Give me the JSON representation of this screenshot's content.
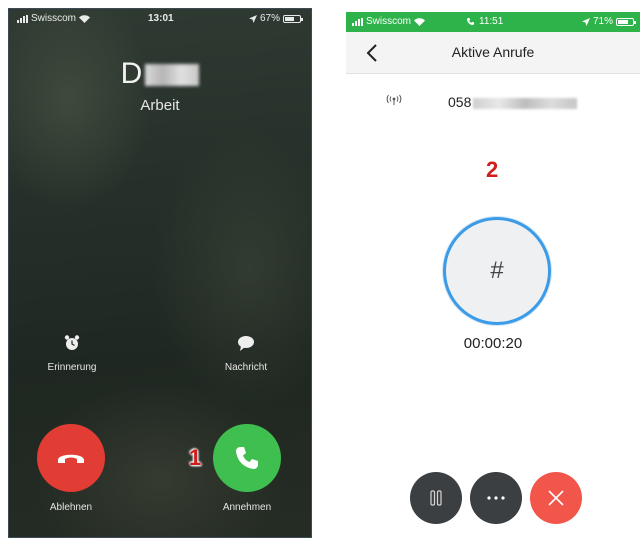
{
  "left_phone": {
    "status_bar": {
      "carrier": "Swisscom",
      "time": "13:01",
      "battery": "67%",
      "battery_level": 0.67
    },
    "caller": {
      "name_visible": "D",
      "label": "Arbeit"
    },
    "actions": {
      "reminder_label": "Erinnerung",
      "message_label": "Nachricht",
      "decline_label": "Ablehnen",
      "accept_label": "Annehmen"
    },
    "marker": "1"
  },
  "right_phone": {
    "status_bar": {
      "carrier": "Swisscom",
      "time": "11:51",
      "battery": "71%",
      "battery_level": 0.71
    },
    "nav": {
      "title": "Aktive Anrufe"
    },
    "call": {
      "number_visible": "058"
    },
    "keypad_label": "#",
    "timer": "00:00:20",
    "marker": "2"
  },
  "colors": {
    "decline": "#e23d34",
    "accept": "#3fbf4f",
    "status_green": "#2eb34a",
    "keypad_ring": "#3c9be6",
    "hangup": "#f2554a",
    "marker": "#d01e1e"
  }
}
